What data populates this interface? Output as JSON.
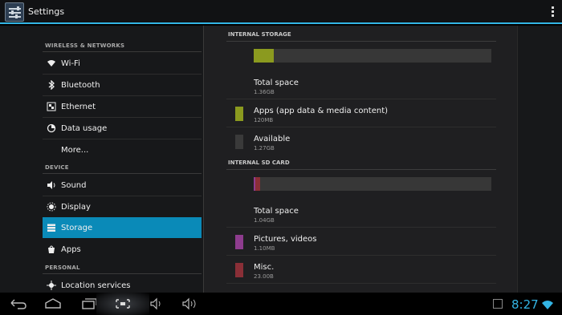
{
  "app": {
    "title": "Settings"
  },
  "sidebar": {
    "sections": [
      {
        "header": "WIRELESS & NETWORKS"
      },
      {
        "header": "DEVICE"
      },
      {
        "header": "PERSONAL"
      }
    ],
    "items": [
      {
        "label": "Wi-Fi",
        "icon": "wifi-icon"
      },
      {
        "label": "Bluetooth",
        "icon": "bluetooth-icon"
      },
      {
        "label": "Ethernet",
        "icon": "ethernet-icon"
      },
      {
        "label": "Data usage",
        "icon": "data-usage-icon"
      },
      {
        "label": "More..."
      },
      {
        "label": "Sound",
        "icon": "speaker-icon"
      },
      {
        "label": "Display",
        "icon": "brightness-icon"
      },
      {
        "label": "Storage",
        "icon": "storage-icon",
        "selected": true
      },
      {
        "label": "Apps",
        "icon": "apps-icon"
      },
      {
        "label": "Location services",
        "icon": "location-icon"
      }
    ]
  },
  "storage": {
    "internal": {
      "header": "INTERNAL STORAGE",
      "used_fraction": 0.086,
      "used_color": "#8b9a1f",
      "total": {
        "label": "Total space",
        "value": "1.36GB"
      },
      "apps": {
        "label": "Apps (app data & media content)",
        "value": "120MB",
        "color": "#8b9a1f"
      },
      "available": {
        "label": "Available",
        "value": "1.27GB",
        "color": "#3a3a3a"
      }
    },
    "sd": {
      "header": "INTERNAL SD CARD",
      "fractions": {
        "pictures": 0.003,
        "misc": 0.02
      },
      "total": {
        "label": "Total space",
        "value": "1.04GB"
      },
      "pictures": {
        "label": "Pictures, videos",
        "value": "1.10MB",
        "color": "#8e3c8e"
      },
      "misc": {
        "label": "Misc.",
        "value": "23.00B",
        "color": "#8a2f37"
      }
    }
  },
  "statusbar": {
    "time": "8:27"
  },
  "colors": {
    "accent": "#33b5e5",
    "selected": "#0a8ab8"
  }
}
